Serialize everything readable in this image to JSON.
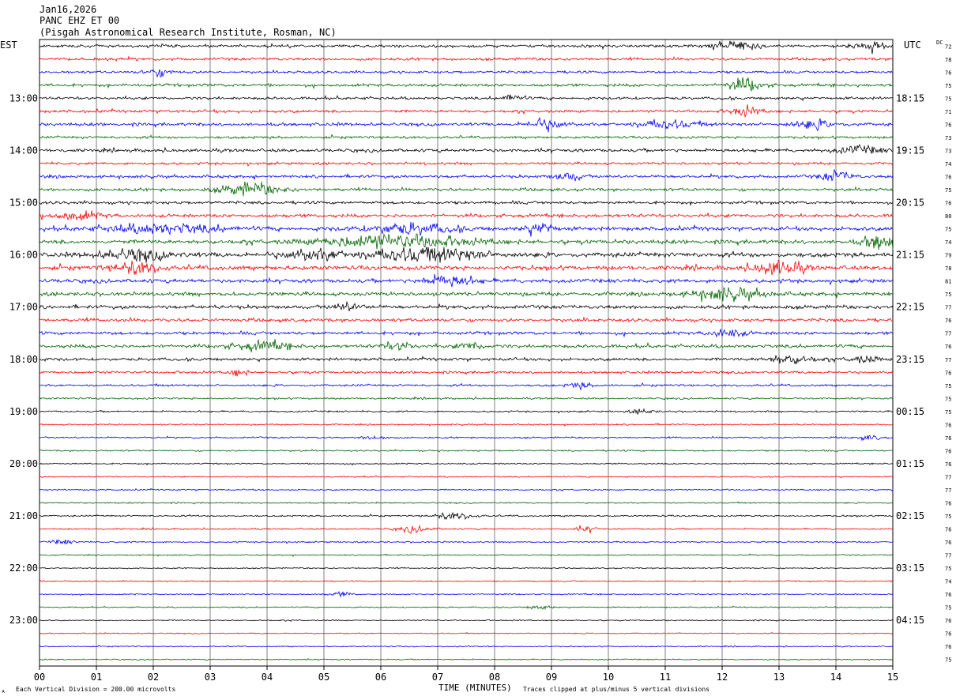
{
  "header": {
    "date": "Jan16,2026",
    "station": "PANC EHZ ET 00",
    "location": "(Pisgah Astronomical Research Institute, Rosman, NC)"
  },
  "labels": {
    "left_timezone": "EST",
    "right_timezone": "UTC",
    "dc_header": "DC"
  },
  "footer": {
    "scale_note": "Each Vertical Division =  200.00 microvolts",
    "xlabel": "TIME (MINUTES)",
    "clip_note": "Traces clipped at plus/minus 5 vertical divisions",
    "corner_mark": "ᴀ"
  },
  "colors": {
    "trace_cycle": [
      "#000000",
      "#ff0000",
      "#0000ff",
      "#006400"
    ],
    "grid": "#000000",
    "background": "#ffffff"
  },
  "chart_data": {
    "type": "line",
    "subtype": "helicorder",
    "x_range_minutes": [
      0,
      15
    ],
    "x_ticks": [
      "00",
      "01",
      "02",
      "03",
      "04",
      "05",
      "06",
      "07",
      "08",
      "09",
      "10",
      "11",
      "12",
      "13",
      "14",
      "15"
    ],
    "rows_per_hour": 4,
    "minutes_per_row": 15,
    "local_hour_labels": [
      "13:00",
      "14:00",
      "15:00",
      "16:00",
      "17:00",
      "18:00",
      "19:00",
      "20:00",
      "21:00",
      "22:00",
      "23:00"
    ],
    "utc_hour_labels": [
      "18:15",
      "19:15",
      "20:15",
      "21:15",
      "22:15",
      "23:15",
      "00:15",
      "01:15",
      "02:15",
      "03:15",
      "04:15"
    ],
    "first_hour_row_index": 4,
    "dc_offsets": [
      72,
      78,
      76,
      75,
      75,
      71,
      76,
      73,
      73,
      74,
      76,
      75,
      76,
      80,
      75,
      74,
      79,
      78,
      81,
      75,
      77,
      76,
      77,
      76,
      77,
      76,
      75,
      75,
      75,
      76,
      76,
      76,
      76,
      77,
      77,
      76,
      75,
      76,
      76,
      77,
      75,
      74,
      76,
      75,
      76,
      76,
      76,
      75
    ],
    "row_amplitude": [
      2.5,
      2.4,
      2.2,
      2.6,
      2.4,
      2.5,
      2.8,
      2.2,
      2.9,
      2.3,
      2.6,
      2.7,
      2.6,
      3.0,
      3.4,
      3.6,
      4.0,
      3.8,
      3.4,
      3.4,
      3.2,
      3.0,
      2.8,
      3.0,
      2.6,
      2.2,
      1.9,
      1.6,
      1.5,
      1.3,
      1.4,
      1.4,
      1.2,
      1.1,
      1.2,
      1.2,
      1.4,
      1.3,
      1.3,
      1.1,
      1.1,
      1.1,
      1.1,
      1.1,
      1.0,
      1.0,
      1.0,
      1.0
    ],
    "events": [
      {
        "row": 0,
        "minute": 12.3,
        "amplitude": 9,
        "duration": 0.8
      },
      {
        "row": 0,
        "minute": 14.6,
        "amplitude": 7,
        "duration": 0.6
      },
      {
        "row": 2,
        "minute": 2.1,
        "amplitude": 6,
        "duration": 0.5
      },
      {
        "row": 3,
        "minute": 12.4,
        "amplitude": 12,
        "duration": 0.6
      },
      {
        "row": 4,
        "minute": 8.3,
        "amplitude": 6,
        "duration": 0.4
      },
      {
        "row": 5,
        "minute": 12.4,
        "amplitude": 8,
        "duration": 0.5
      },
      {
        "row": 6,
        "minute": 8.9,
        "amplitude": 11,
        "duration": 0.6
      },
      {
        "row": 6,
        "minute": 11.0,
        "amplitude": 7,
        "duration": 1.0
      },
      {
        "row": 6,
        "minute": 13.6,
        "amplitude": 7,
        "duration": 0.8
      },
      {
        "row": 8,
        "minute": 14.4,
        "amplitude": 7,
        "duration": 0.8
      },
      {
        "row": 10,
        "minute": 9.3,
        "amplitude": 7,
        "duration": 0.5
      },
      {
        "row": 10,
        "minute": 14.0,
        "amplitude": 9,
        "duration": 0.5
      },
      {
        "row": 11,
        "minute": 3.7,
        "amplitude": 11,
        "duration": 1.0
      },
      {
        "row": 13,
        "minute": 0.7,
        "amplitude": 7,
        "duration": 0.8
      },
      {
        "row": 14,
        "minute": 2.2,
        "amplitude": 8,
        "duration": 2.0
      },
      {
        "row": 14,
        "minute": 6.5,
        "amplitude": 9,
        "duration": 1.5
      },
      {
        "row": 14,
        "minute": 8.8,
        "amplitude": 10,
        "duration": 0.5
      },
      {
        "row": 15,
        "minute": 6.2,
        "amplitude": 12,
        "duration": 2.5
      },
      {
        "row": 15,
        "minute": 14.8,
        "amplitude": 14,
        "duration": 0.6
      },
      {
        "row": 16,
        "minute": 1.7,
        "amplitude": 9,
        "duration": 1.2
      },
      {
        "row": 16,
        "minute": 4.8,
        "amplitude": 8,
        "duration": 1.2
      },
      {
        "row": 16,
        "minute": 6.8,
        "amplitude": 12,
        "duration": 2.0
      },
      {
        "row": 17,
        "minute": 1.7,
        "amplitude": 10,
        "duration": 0.8
      },
      {
        "row": 17,
        "minute": 13.0,
        "amplitude": 13,
        "duration": 0.8
      },
      {
        "row": 18,
        "minute": 7.2,
        "amplitude": 9,
        "duration": 0.9
      },
      {
        "row": 19,
        "minute": 12.1,
        "amplitude": 10,
        "duration": 1.2
      },
      {
        "row": 20,
        "minute": 5.4,
        "amplitude": 6,
        "duration": 0.5
      },
      {
        "row": 22,
        "minute": 12.1,
        "amplitude": 7,
        "duration": 0.6
      },
      {
        "row": 23,
        "minute": 3.9,
        "amplitude": 8,
        "duration": 1.0
      },
      {
        "row": 23,
        "minute": 6.3,
        "amplitude": 7,
        "duration": 0.5
      },
      {
        "row": 23,
        "minute": 7.6,
        "amplitude": 6,
        "duration": 0.5
      },
      {
        "row": 24,
        "minute": 13.2,
        "amplitude": 8,
        "duration": 0.8
      },
      {
        "row": 24,
        "minute": 14.5,
        "amplitude": 6,
        "duration": 0.5
      },
      {
        "row": 25,
        "minute": 3.5,
        "amplitude": 6,
        "duration": 0.3
      },
      {
        "row": 26,
        "minute": 9.5,
        "amplitude": 5,
        "duration": 0.4
      },
      {
        "row": 28,
        "minute": 10.6,
        "amplitude": 4,
        "duration": 0.4
      },
      {
        "row": 30,
        "minute": 5.9,
        "amplitude": 4,
        "duration": 0.4
      },
      {
        "row": 30,
        "minute": 14.6,
        "amplitude": 4,
        "duration": 0.4
      },
      {
        "row": 36,
        "minute": 7.3,
        "amplitude": 6,
        "duration": 0.7
      },
      {
        "row": 37,
        "minute": 6.6,
        "amplitude": 5,
        "duration": 0.6
      },
      {
        "row": 37,
        "minute": 9.6,
        "amplitude": 4,
        "duration": 0.4
      },
      {
        "row": 38,
        "minute": 0.4,
        "amplitude": 4,
        "duration": 0.4
      },
      {
        "row": 42,
        "minute": 5.3,
        "amplitude": 4,
        "duration": 0.4
      },
      {
        "row": 43,
        "minute": 8.8,
        "amplitude": 4,
        "duration": 0.4
      }
    ]
  }
}
